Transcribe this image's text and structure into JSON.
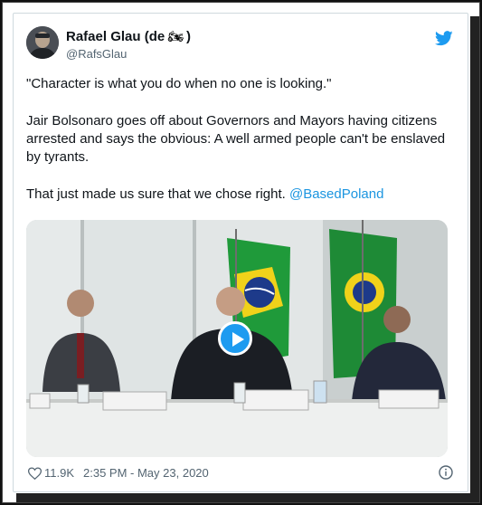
{
  "author": {
    "name": "Rafael Glau (de",
    "name_suffix": ")",
    "name_emoji": "🏍",
    "handle": "@RafsGlau"
  },
  "tweet": {
    "paragraph_1": "\"Character is what you do when no one is looking.\"",
    "paragraph_2": "Jair Bolsonaro goes off about Governors and Mayors having citizens arrested and says the obvious: A well armed people can't be enslaved by tyrants.",
    "paragraph_3": "That just made us sure that we chose right.",
    "mention": "@BasedPoland"
  },
  "footer": {
    "likes": "11.9K",
    "timestamp": "2:35 PM - May 23, 2020"
  },
  "icons": {
    "brand": "twitter-bird-icon",
    "like": "heart-icon",
    "info": "info-icon",
    "play": "play-icon"
  },
  "colors": {
    "link": "#1b95e0",
    "twitter_blue": "#1d9bf0",
    "text": "#0f1419",
    "muted": "#536471"
  }
}
